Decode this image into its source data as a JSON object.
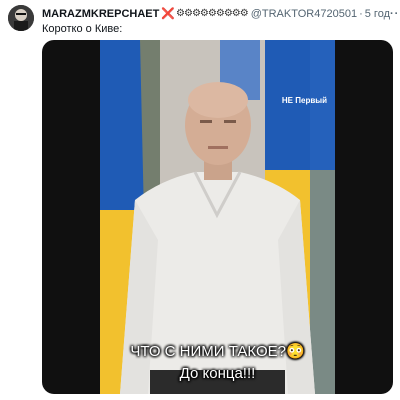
{
  "tweet": {
    "display_name": "MARAZMKREPCHAET",
    "x_symbol": "❌",
    "gear_symbols": "⚙⚙⚙⚙⚙⚙⚙⚙⚙",
    "handle": "@TRAKTOR4720501",
    "separator": "·",
    "time": "5 год",
    "more_label": "···",
    "text": "Коротко о Киве:"
  },
  "video": {
    "badge": "НЕ Первый",
    "caption_line1": "ЧТО С НИМИ ТАКОЕ?😳",
    "caption_line2": "До конца!!!"
  },
  "colors": {
    "flag_blue": "#1f5bb5",
    "flag_yellow": "#f2c12e",
    "x_red": "#e0245e"
  }
}
